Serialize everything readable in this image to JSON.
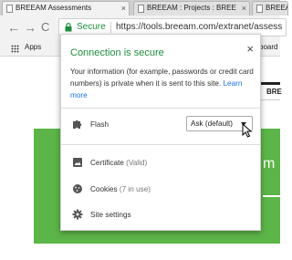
{
  "tabs": [
    {
      "title": "BREEAM Assessments",
      "close": "×",
      "active": true
    },
    {
      "title": "BREEAM : Projects : BREE",
      "close": "×",
      "active": false
    },
    {
      "title": "BREEAM Assessments",
      "close": "×",
      "active": false
    }
  ],
  "toolbar": {
    "back": "←",
    "forward": "→",
    "reload": "C",
    "secure_label": "Secure",
    "url": "https://tools.breeam.com/extranet/assess"
  },
  "bookmarks": {
    "apps_label": "Apps",
    "right_item": "board"
  },
  "page": {
    "edge_text": "BRE",
    "green_letter": "m"
  },
  "popup": {
    "title": "Connection is secure",
    "close": "×",
    "description": "Your information (for example, passwords or credit card numbers) is private when it is sent to this site.",
    "learn_more": "Learn more",
    "flash": {
      "label": "Flash",
      "value": "Ask (default)",
      "icon": "puzzle-icon"
    },
    "certificate": {
      "label": "Certificate",
      "detail": "(Valid)",
      "icon": "certificate-icon"
    },
    "cookies": {
      "label": "Cookies",
      "detail": "(7 in use)",
      "icon": "cookie-icon"
    },
    "site_settings": {
      "label": "Site settings",
      "icon": "gear-icon"
    }
  },
  "colors": {
    "secure_green": "#1e8e3e",
    "link_blue": "#1a73e8",
    "page_green": "#5cb548"
  }
}
